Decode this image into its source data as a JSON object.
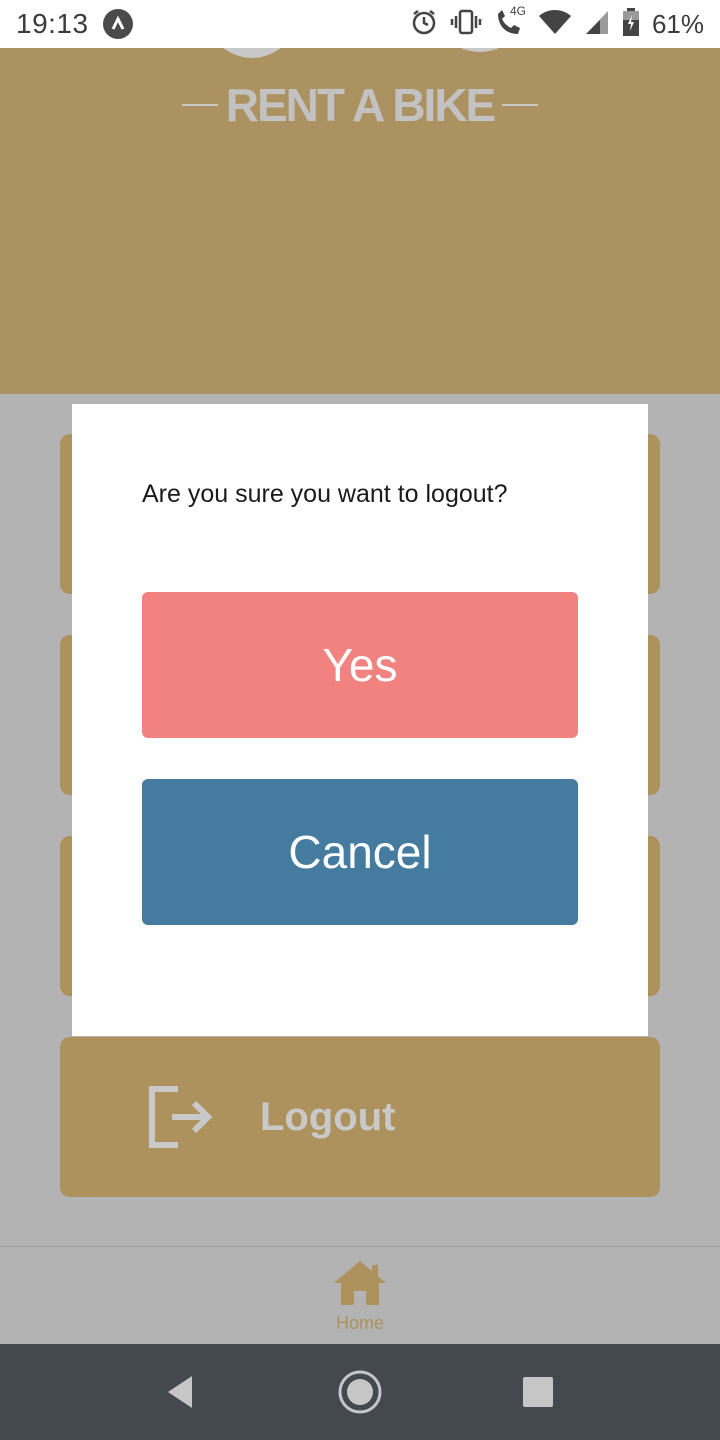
{
  "status_bar": {
    "time": "19:13",
    "network": "4G",
    "battery": "61%",
    "icons": [
      "app-notification-icon",
      "alarm-icon",
      "vibrate-icon",
      "call-4g-icon",
      "wifi-icon",
      "signal-icon",
      "battery-icon"
    ]
  },
  "header": {
    "title": "RENT A BIKE",
    "background_color": "#ab9260"
  },
  "menu": {
    "logout_label": "Logout",
    "card_color": "#ad925e"
  },
  "dialog": {
    "message": "Are you sure you want to logout?",
    "yes_label": "Yes",
    "cancel_label": "Cancel",
    "yes_color": "#f1827f",
    "cancel_color": "#447b9f"
  },
  "bottom_nav": {
    "home_label": "Home"
  }
}
